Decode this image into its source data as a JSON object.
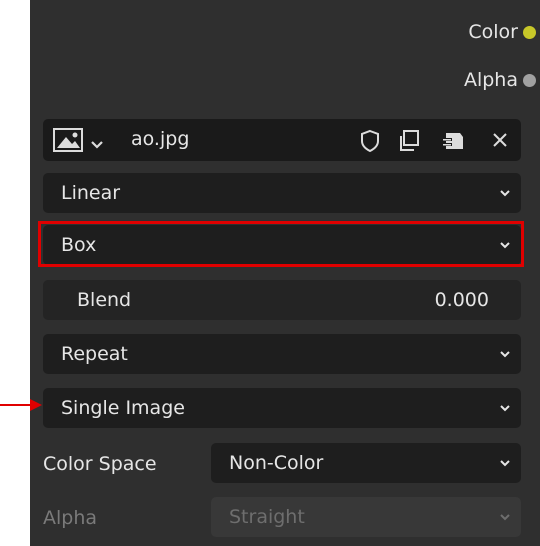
{
  "sockets": [
    {
      "label": "Color",
      "color": "#c7c729"
    },
    {
      "label": "Alpha",
      "color": "#a1a1a1"
    }
  ],
  "image_block": {
    "filename": "ao.jpg",
    "icons": [
      "image-icon",
      "chevron-down-icon",
      "shield-icon",
      "duplicate-icon",
      "pack-icon",
      "close-icon"
    ]
  },
  "interpolation": {
    "value": "Linear"
  },
  "projection": {
    "value": "Box",
    "highlight_color": "#e00000"
  },
  "blend": {
    "label": "Blend",
    "value": "0.000"
  },
  "extension": {
    "value": "Repeat"
  },
  "source": {
    "value": "Single Image"
  },
  "color_space": {
    "label": "Color Space",
    "value": "Non-Color"
  },
  "alpha": {
    "label": "Alpha",
    "value": "Straight"
  },
  "annotation_arrow_color": "#e00000"
}
